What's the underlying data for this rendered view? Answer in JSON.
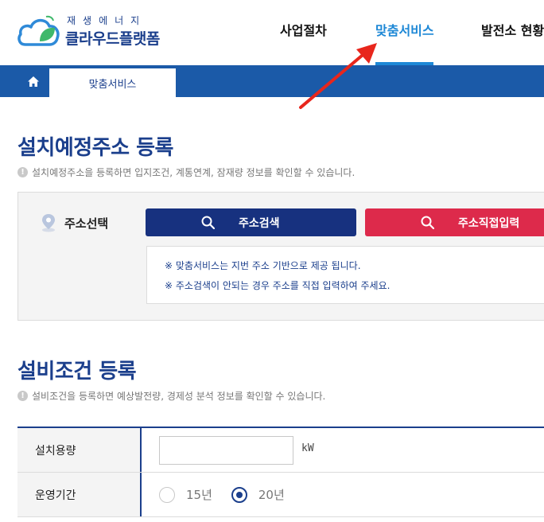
{
  "header": {
    "logo_sub": "재생에너지",
    "logo_main": "클라우드플랫폼",
    "nav": [
      "사업절차",
      "맞춤서비스",
      "발전소 현황"
    ],
    "active_nav": "맞춤서비스"
  },
  "breadcrumb": {
    "current": "맞춤서비스"
  },
  "address_section": {
    "title": "설치예정주소 등록",
    "description": "설치예정주소을 등록하면 입지조건, 계통연계, 잠재량 정보를 확인할 수 있습니다.",
    "label": "주소선택",
    "search_button": "주소검색",
    "direct_button": "주소직접입력",
    "notices": [
      "※ 맞춤서비스는 지번 주소 기반으로 제공 됩니다.",
      "※ 주소검색이 안되는 경우 주소를 직접 입력하여 주세요."
    ]
  },
  "equipment_section": {
    "title": "설비조건 등록",
    "description": "설비조건을 등록하면 예상발전량, 경제성 분석 정보를 확인할 수 있습니다.",
    "capacity_label": "설치용량",
    "capacity_value": "",
    "capacity_unit": "kW",
    "period_label": "운영기간",
    "period_options": [
      "15년",
      "20년"
    ],
    "period_selected": "20년"
  },
  "colors": {
    "brand_navy": "#1b3f8c",
    "nav_active": "#1e88d6",
    "crumb_bar": "#1b5aa8",
    "search_button": "#17317f",
    "direct_button": "#dd2a4b",
    "annotation_arrow": "#e8261c"
  },
  "icons": [
    "cloud-leaf-logo-icon",
    "home-icon",
    "location-pin-icon",
    "search-icon",
    "info-icon",
    "red-arrow-annotation"
  ]
}
